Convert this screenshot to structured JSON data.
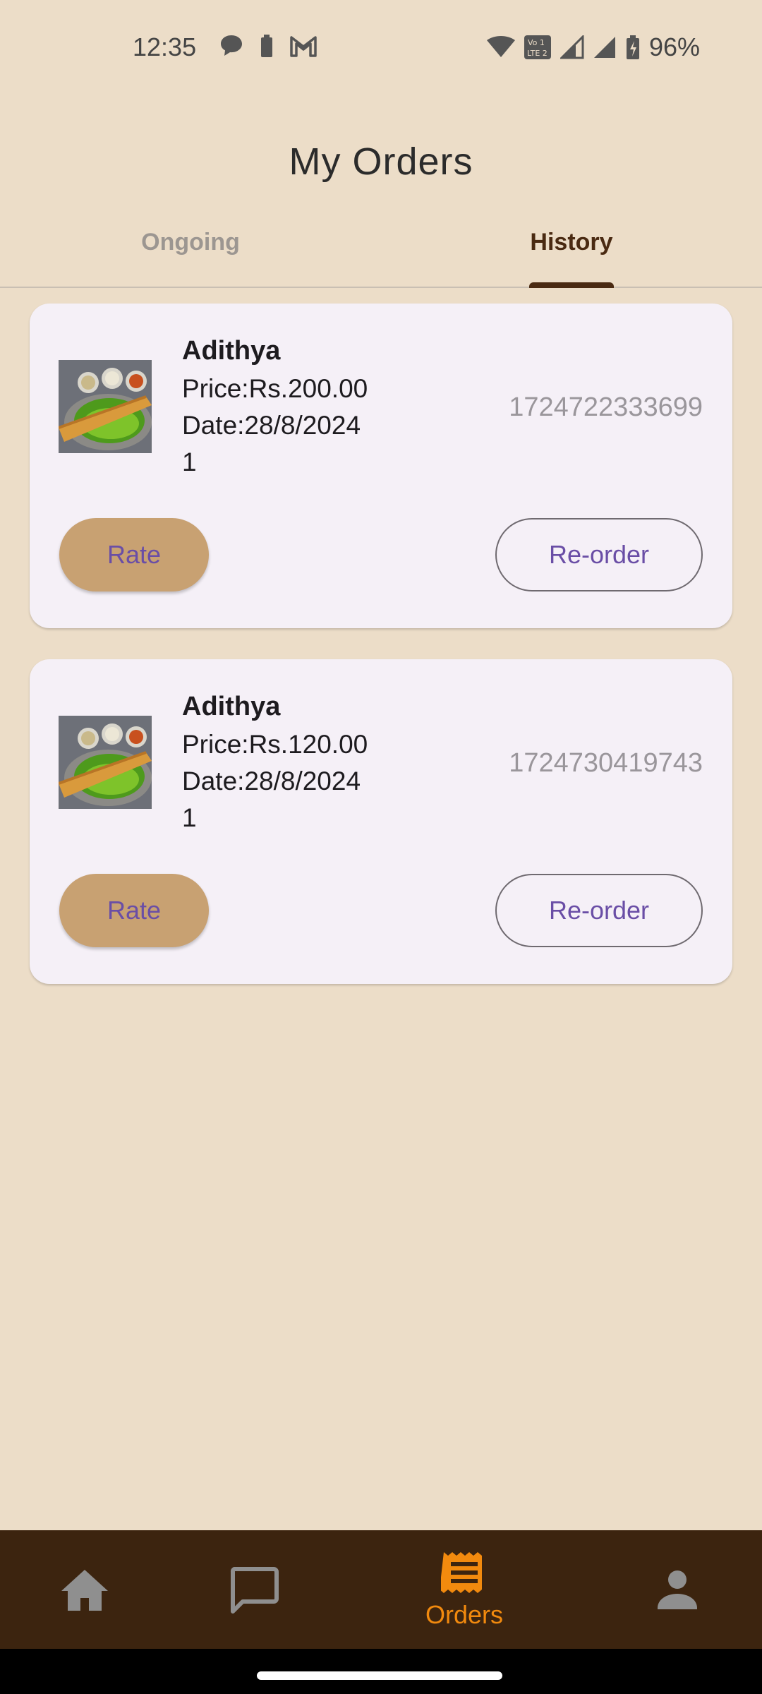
{
  "status_bar": {
    "time": "12:35",
    "battery_percent": "96%",
    "icons_left": [
      "chat-bubble-icon",
      "battery-small-icon",
      "gmail-icon"
    ],
    "icons_right": [
      "wifi-icon",
      "volte-icon",
      "signal-icon",
      "signal-icon",
      "battery-charging-icon"
    ]
  },
  "header": {
    "title": "My Orders"
  },
  "tabs": [
    {
      "label": "Ongoing",
      "selected": false
    },
    {
      "label": "History",
      "selected": true
    }
  ],
  "orders": [
    {
      "name": "Adithya",
      "price": "Price:Rs.200.00",
      "date": "Date:28/8/2024",
      "quantity": "1",
      "order_id": "1724722333699",
      "rate_label": "Rate",
      "reorder_label": "Re-order"
    },
    {
      "name": "Adithya",
      "price": "Price:Rs.120.00",
      "date": "Date:28/8/2024",
      "quantity": "1",
      "order_id": "1724730419743",
      "rate_label": "Rate",
      "reorder_label": "Re-order"
    }
  ],
  "bottom_nav": {
    "items": [
      {
        "icon": "home-icon",
        "label": ""
      },
      {
        "icon": "chat-icon",
        "label": ""
      },
      {
        "icon": "receipt-icon",
        "label": "Orders",
        "selected": true
      },
      {
        "icon": "profile-icon",
        "label": ""
      }
    ]
  },
  "colors": {
    "background": "#ECDDC8",
    "card": "#F5F0F7",
    "accent_brown": "#4A2A12",
    "rate_button": "#C8A172",
    "button_text": "#6A4EA6",
    "nav_background": "#3C240F",
    "nav_active": "#F28A0E"
  }
}
